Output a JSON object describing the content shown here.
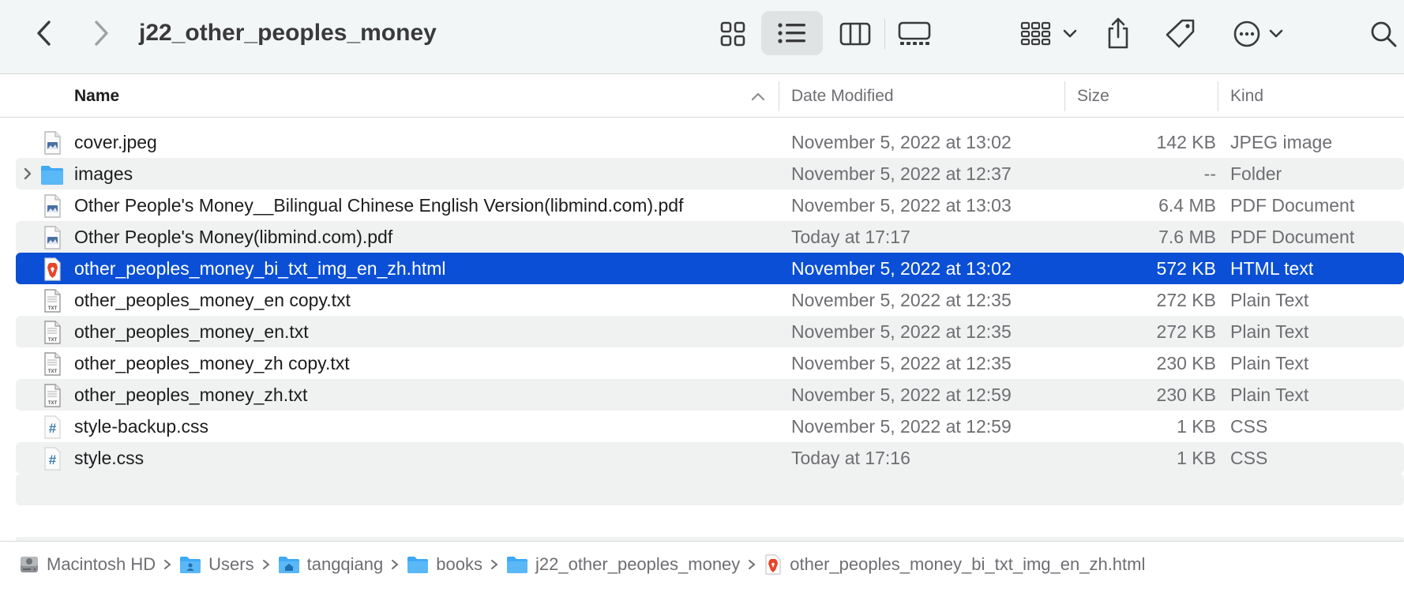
{
  "window": {
    "title": "j22_other_peoples_money"
  },
  "toolbar": {
    "back_icon": "chevron-left-icon",
    "forward_icon": "chevron-right-icon",
    "view_modes": [
      "icon-view",
      "list-view",
      "column-view",
      "gallery-view"
    ],
    "active_view": "list-view"
  },
  "columns": {
    "name": "Name",
    "date": "Date Modified",
    "size": "Size",
    "kind": "Kind",
    "sort": "name-ascending"
  },
  "files": [
    {
      "name": "cover.jpeg",
      "date": "November 5, 2022 at 13:02",
      "size": "142 KB",
      "kind": "JPEG image",
      "icon": "image-file-icon",
      "selected": false
    },
    {
      "name": "images",
      "date": "November 5, 2022 at 12:37",
      "size": "--",
      "kind": "Folder",
      "icon": "folder-icon",
      "selected": false,
      "expandable": true
    },
    {
      "name": "Other People's Money__Bilingual Chinese English Version(libmind.com).pdf",
      "date": "November 5, 2022 at 13:03",
      "size": "6.4 MB",
      "kind": "PDF Document",
      "icon": "pdf-file-icon",
      "selected": false
    },
    {
      "name": "Other People's Money(libmind.com).pdf",
      "date": "Today at 17:17",
      "size": "7.6 MB",
      "kind": "PDF Document",
      "icon": "pdf-file-icon",
      "selected": false
    },
    {
      "name": "other_peoples_money_bi_txt_img_en_zh.html",
      "date": "November 5, 2022 at 13:02",
      "size": "572 KB",
      "kind": "HTML text",
      "icon": "brave-html-icon",
      "selected": true
    },
    {
      "name": "other_peoples_money_en copy.txt",
      "date": "November 5, 2022 at 12:35",
      "size": "272 KB",
      "kind": "Plain Text",
      "icon": "txt-file-icon",
      "selected": false
    },
    {
      "name": "other_peoples_money_en.txt",
      "date": "November 5, 2022 at 12:35",
      "size": "272 KB",
      "kind": "Plain Text",
      "icon": "txt-file-icon",
      "selected": false
    },
    {
      "name": "other_peoples_money_zh copy.txt",
      "date": "November 5, 2022 at 12:35",
      "size": "230 KB",
      "kind": "Plain Text",
      "icon": "txt-file-icon",
      "selected": false
    },
    {
      "name": "other_peoples_money_zh.txt",
      "date": "November 5, 2022 at 12:59",
      "size": "230 KB",
      "kind": "Plain Text",
      "icon": "txt-file-icon",
      "selected": false
    },
    {
      "name": "style-backup.css",
      "date": "November 5, 2022 at 12:59",
      "size": "1 KB",
      "kind": "CSS",
      "icon": "css-file-icon",
      "selected": false
    },
    {
      "name": "style.css",
      "date": "Today at 17:16",
      "size": "1 KB",
      "kind": "CSS",
      "icon": "css-file-icon",
      "selected": false
    }
  ],
  "path_bar": [
    {
      "label": "Macintosh HD",
      "icon": "hard-drive-icon"
    },
    {
      "label": "Users",
      "icon": "users-folder-icon"
    },
    {
      "label": "tangqiang",
      "icon": "home-folder-icon"
    },
    {
      "label": "books",
      "icon": "folder-icon"
    },
    {
      "label": "j22_other_peoples_money",
      "icon": "folder-icon"
    },
    {
      "label": "other_peoples_money_bi_txt_img_en_zh.html",
      "icon": "brave-html-icon"
    }
  ],
  "colors": {
    "selection": "#0a4fd6",
    "folder": "#3fa9f5",
    "toolbar_bg": "#f3f6f6",
    "alt_row": "#f0f1f1"
  }
}
